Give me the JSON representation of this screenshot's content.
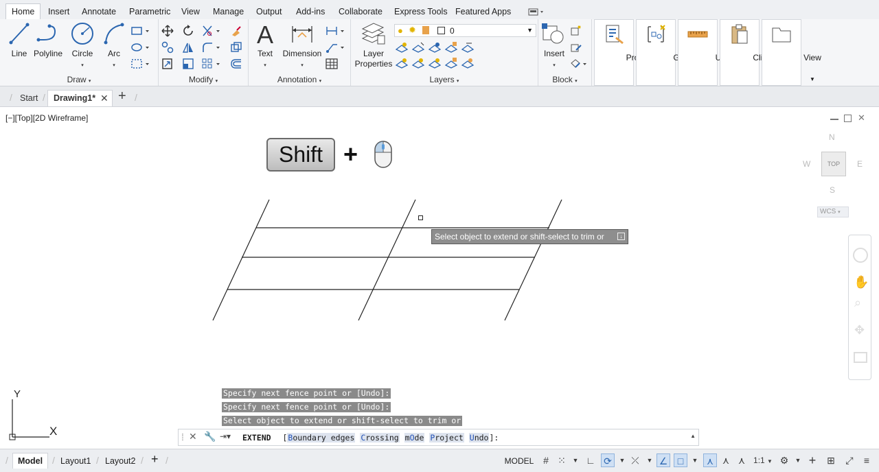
{
  "ribbon_tabs": [
    "Home",
    "Insert",
    "Annotate",
    "Parametric",
    "View",
    "Manage",
    "Output",
    "Add-ins",
    "Collaborate",
    "Express Tools",
    "Featured Apps"
  ],
  "draw": {
    "title": "Draw",
    "line": "Line",
    "polyline": "Polyline",
    "circle": "Circle",
    "arc": "Arc"
  },
  "modify": {
    "title": "Modify"
  },
  "annotation": {
    "title": "Annotation",
    "text": "Text",
    "dimension": "Dimension"
  },
  "layers": {
    "title": "Layers",
    "layer_properties_line1": "Layer",
    "layer_properties_line2": "Properties",
    "current_layer": "0"
  },
  "block": {
    "title": "Block",
    "insert": "Insert"
  },
  "flyouts": {
    "properties": "Properties",
    "groups": "Groups",
    "utilities": "Utilities",
    "clipboard": "Clipboard",
    "view": "View"
  },
  "file_tabs": {
    "start": "Start",
    "drawing": "Drawing1*",
    "new_tab_symbol": "+"
  },
  "viewport": {
    "label": "[−][Top][2D Wireframe]",
    "shift_key": "Shift",
    "plus": "+"
  },
  "viewcube": {
    "north": "N",
    "south": "S",
    "east": "E",
    "west": "W",
    "top": "TOP",
    "wcs": "WCS"
  },
  "ucs": {
    "x": "X",
    "y": "Y"
  },
  "tooltip": "Select object to extend or shift-select to trim or",
  "command_history": [
    "Specify next fence point or [Undo]:",
    "Specify next fence point or [Undo]:",
    "Select object to extend or shift-select to trim or"
  ],
  "command_line": {
    "command": "EXTEND",
    "open_bracket": "[",
    "options": [
      {
        "key": "B",
        "rest": "oundary edges"
      },
      {
        "key": "C",
        "rest": "rossing"
      },
      {
        "pre": "m",
        "key": "O",
        "rest": "de"
      },
      {
        "key": "P",
        "rest": "roject"
      },
      {
        "key": "U",
        "rest": "ndo"
      }
    ],
    "close": "]:"
  },
  "status": {
    "model_tab": "Model",
    "layout1": "Layout1",
    "layout2": "Layout2",
    "model_button": "MODEL",
    "scale": "1:1"
  },
  "colors": {
    "accent": "#2b66b0",
    "tooltip_bg": "#8e8e8e",
    "history_bg": "#8a8a8a"
  }
}
